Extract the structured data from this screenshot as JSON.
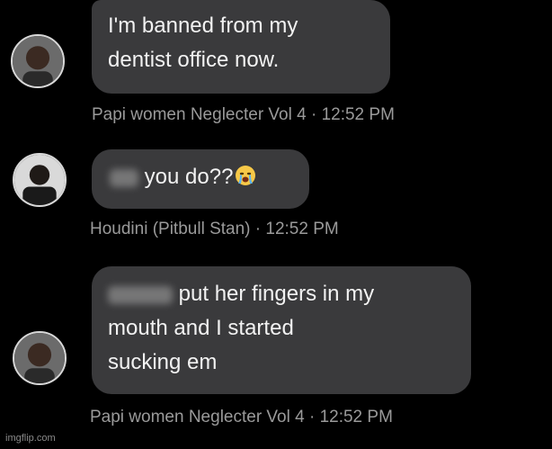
{
  "messages": [
    {
      "lines": [
        "I'm banned from my",
        "dentist office now."
      ],
      "sender": "Papi women Neglecter Vol 4",
      "time": "· 12:52 PM"
    },
    {
      "text": "you do??",
      "emoji": "crying-face-icon",
      "sender": "Houdini (Pitbull Stan)",
      "time": "· 12:52 PM"
    },
    {
      "line1_rest": "put her fingers in my",
      "line2": "mouth and I started",
      "line3": "sucking em",
      "sender": "Papi women Neglecter Vol 4",
      "time": "· 12:52 PM"
    }
  ],
  "watermark": "imgflip.com"
}
